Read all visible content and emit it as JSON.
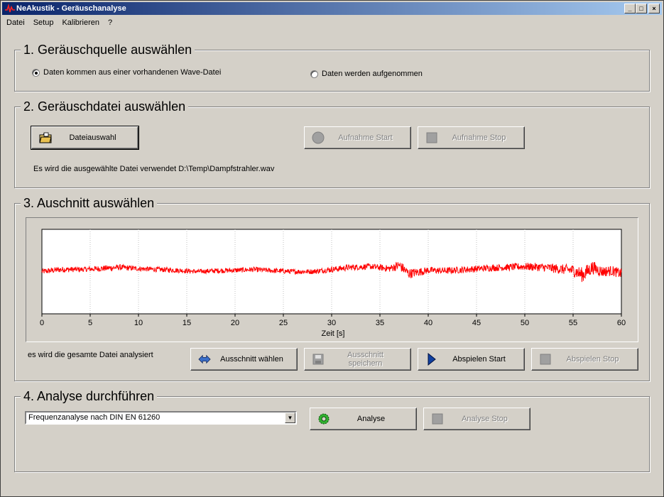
{
  "window": {
    "title": "NeAkustik - Geräuschanalyse",
    "buttons": [
      "_",
      "□",
      "×"
    ]
  },
  "menu": [
    "Datei",
    "Setup",
    "Kalibrieren",
    "?"
  ],
  "section1": {
    "title": "1. Geräuschquelle auswählen",
    "option_file": "Daten kommen aus einer vorhandenen Wave-Datei",
    "option_record": "Daten werden aufgenommen",
    "selected": "file"
  },
  "section2": {
    "title": "2. Geräuschdatei auswählen",
    "file_button": "Dateiauswahl",
    "record_start": "Aufnahme Start",
    "record_stop": "Aufnahme Stop",
    "status": "Es wird die ausgewählte Datei verwendet D:\\Temp\\Dampfstrahler.wav"
  },
  "section3": {
    "title": "3. Auschnitt auswählen",
    "info": "es wird die gesamte Datei analysiert",
    "select_button": "Ausschnitt wählen",
    "save_button": "Ausschnitt speichern",
    "play_start": "Abspielen Start",
    "play_stop": "Abspielen Stop"
  },
  "section4": {
    "title": "4. Analyse durchführen",
    "analysis_type": "Frequenzanalyse nach DIN EN 61260",
    "analyse_button": "Analyse",
    "analyse_stop": "Analyse Stop"
  },
  "chart_data": {
    "type": "line",
    "xlabel": "Zeit [s]",
    "ylabel": "",
    "xlim": [
      0,
      60
    ],
    "x_ticks": [
      0,
      5,
      10,
      15,
      20,
      25,
      30,
      35,
      40,
      45,
      50,
      55,
      60
    ],
    "grid": "vertical",
    "line_color": "#ff0000",
    "series": [
      {
        "x": [
          0,
          2,
          4,
          6,
          8,
          10,
          12,
          14,
          16,
          18,
          20,
          22,
          24,
          26,
          28,
          30,
          32,
          34,
          36,
          37,
          38,
          40,
          42,
          44,
          46,
          48,
          50,
          52,
          54,
          55,
          56,
          57,
          58,
          59,
          60
        ],
        "y": [
          0.0,
          0.05,
          0.05,
          0.07,
          0.1,
          0.07,
          0.05,
          0.03,
          0.0,
          0.02,
          0.03,
          0.05,
          0.02,
          0.0,
          0.0,
          0.05,
          0.1,
          0.12,
          0.07,
          0.15,
          -0.05,
          0.03,
          0.02,
          0.05,
          0.08,
          0.1,
          0.12,
          0.1,
          0.05,
          0.03,
          -0.08,
          0.1,
          0.0,
          0.02,
          -0.05
        ],
        "amplitude": [
          0.07,
          0.07,
          0.06,
          0.07,
          0.07,
          0.06,
          0.06,
          0.06,
          0.05,
          0.06,
          0.06,
          0.06,
          0.06,
          0.06,
          0.06,
          0.07,
          0.07,
          0.07,
          0.08,
          0.12,
          0.12,
          0.08,
          0.08,
          0.08,
          0.08,
          0.08,
          0.09,
          0.1,
          0.12,
          0.14,
          0.18,
          0.16,
          0.13,
          0.12,
          0.12
        ]
      }
    ]
  }
}
